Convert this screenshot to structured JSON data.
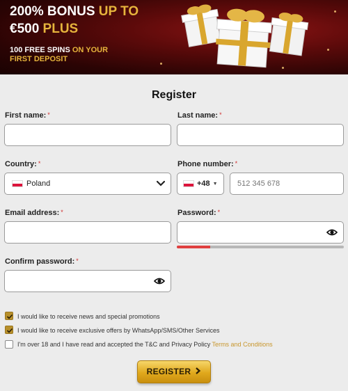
{
  "banner": {
    "bonus_prefix": "200% BONUS ",
    "bonus_highlight": "UP TO",
    "amount": "€500 ",
    "amount_highlight": "PLUS",
    "spins_prefix": "100 FREE SPINS ",
    "spins_highlight": "ON YOUR",
    "first_deposit": "FIRST DEPOSIT"
  },
  "form": {
    "title": "Register",
    "first_name": {
      "label": "First name:",
      "required": "*",
      "value": ""
    },
    "last_name": {
      "label": "Last name:",
      "required": "*",
      "value": ""
    },
    "country": {
      "label": "Country:",
      "required": "*",
      "value": "Poland"
    },
    "phone": {
      "label": "Phone number:",
      "required": "*",
      "code": "+48",
      "placeholder": "512 345 678"
    },
    "email": {
      "label": "Email address:",
      "required": "*",
      "value": ""
    },
    "password": {
      "label": "Password:",
      "required": "*",
      "value": "",
      "strength": 0.2
    },
    "confirm_password": {
      "label": "Confirm password:",
      "required": "*",
      "value": ""
    },
    "checkboxes": [
      {
        "label": "I would like to receive news and special promotions",
        "checked": true
      },
      {
        "label": "I would like to receive exclusive offers by WhatsApp/SMS/Other Services",
        "checked": true
      },
      {
        "label": "I'm over 18 and I have read and accepted the T&C and Privacy Policy ",
        "link": "Terms and Conditions",
        "checked": false
      }
    ],
    "submit_label": "REGISTER"
  },
  "colors": {
    "accent_gold": "#e6b43c",
    "button_gold": "#e0a81c",
    "strength_weak": "#e04040",
    "banner_red": "#5c0a0a"
  },
  "icons": {
    "eye": "eye-icon",
    "chevron": "chevron-down-icon",
    "flag": "poland-flag-icon",
    "arrow": "chevron-right-icon",
    "check": "check-icon"
  }
}
